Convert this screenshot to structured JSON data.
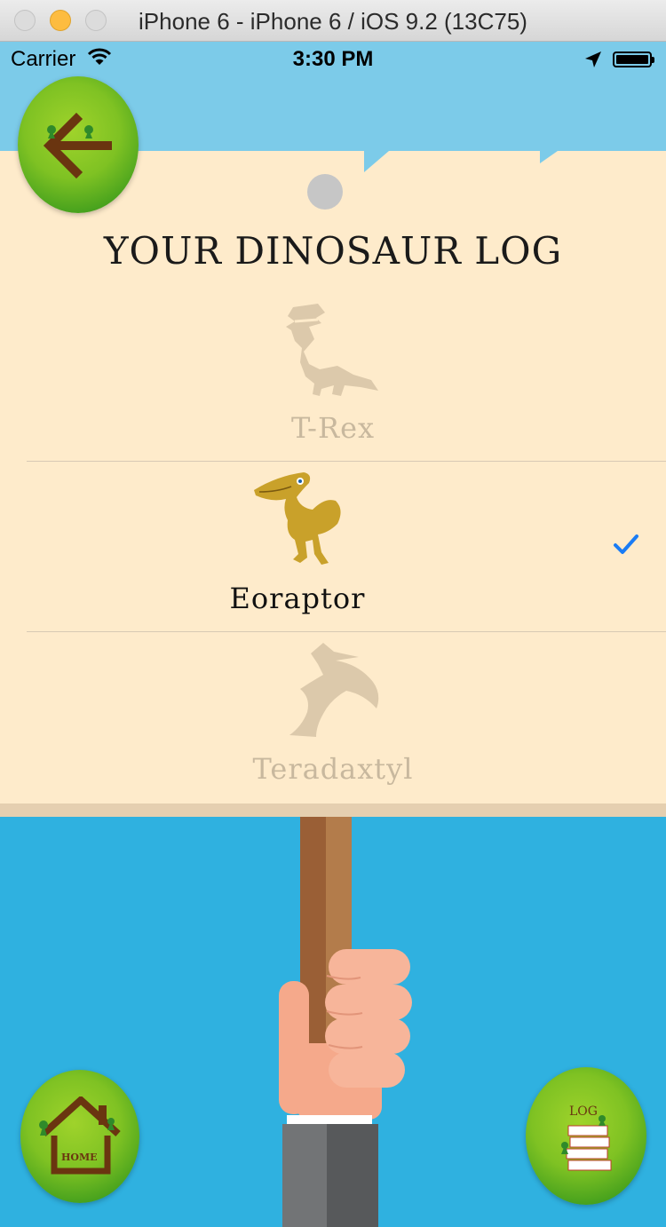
{
  "window": {
    "title": "iPhone 6 - iPhone 6 / iOS 9.2 (13C75)"
  },
  "status_bar": {
    "carrier": "Carrier",
    "time": "3:30 PM",
    "icons": [
      "wifi-icon",
      "location-arrow-icon",
      "battery-icon"
    ]
  },
  "sign": {
    "title": "YOUR DINOSAUR LOG"
  },
  "dinosaurs": [
    {
      "name": "T-Rex",
      "icon": "t-rex-icon",
      "unlocked": false,
      "selected": false
    },
    {
      "name": "Eoraptor",
      "icon": "eoraptor-icon",
      "unlocked": true,
      "selected": true
    },
    {
      "name": "Teradaxtyl",
      "icon": "pterodactyl-icon",
      "unlocked": false,
      "selected": false
    }
  ],
  "buttons": {
    "back": {
      "icon": "back-arrow-icon"
    },
    "home": {
      "label": "HOME",
      "icon": "house-icon"
    },
    "log": {
      "label": "LOG",
      "icon": "books-icon"
    }
  },
  "colors": {
    "sky": "#7ccbe9",
    "background": "#2fb1e0",
    "sign": "#feebcb",
    "muted_text": "#c8b89e",
    "button_green": "#7fc223",
    "checkmark": "#1a7cf5"
  }
}
